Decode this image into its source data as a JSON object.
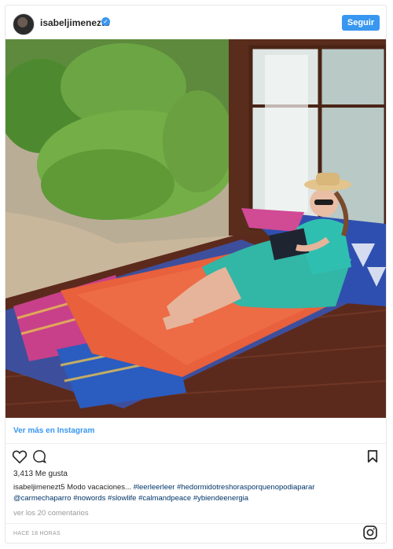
{
  "post": {
    "username": "isabeljimenezt5",
    "follow_label": "Seguir",
    "view_more": "Ver más en Instagram",
    "likes": "3,413 Me gusta",
    "caption_user": "isabeljimenezt5",
    "caption_text": "Modo vacaciones...",
    "hashtags_line1": [
      "#leerleerleer",
      "#hedormidotreshorasporquenopodiaparar"
    ],
    "mentions_line2": [
      "@carmechaparro",
      "#nowords",
      "#slowlife",
      "#calmandpeace",
      "#ybiendeenergia"
    ],
    "comments_link": "ver los 20 comentarios",
    "time_ago": "HACE 18 HORAS"
  },
  "icons": {
    "verified": "verified-badge-icon",
    "like": "heart-icon",
    "comment": "comment-bubble-icon",
    "save": "bookmark-icon",
    "logo": "instagram-logo-icon"
  },
  "colors": {
    "accent": "#3897f0",
    "hashtag": "#003569",
    "muted": "#999999",
    "border": "#e6e6e6"
  }
}
